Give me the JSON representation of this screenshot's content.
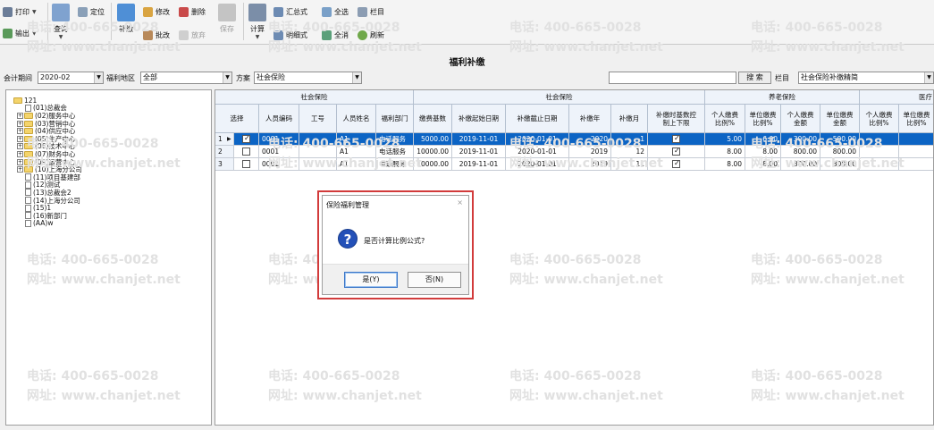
{
  "toolbar": {
    "print": "打印",
    "export": "输出",
    "query": "查询",
    "locate": "定位",
    "supplement": "补缴",
    "edit": "修改",
    "delete": "删除",
    "batch_edit": "批改",
    "void": "放弃",
    "save": "保存",
    "calculate": "计算",
    "summary_style": "汇总式",
    "detail_style": "明细式",
    "select_all": "全选",
    "deselect_all": "全消",
    "columns": "栏目",
    "refresh": "刷新"
  },
  "page_title": "福利补缴",
  "filters": {
    "period_label": "会计期间",
    "period_value": "2020-02",
    "region_label": "福利地区",
    "region_value": "全部",
    "plan_label": "方案",
    "plan_value": "社会保险",
    "search_button": "搜 索",
    "column_label": "栏目",
    "column_value": "社会保险补缴精简"
  },
  "tree": {
    "root": "121",
    "items": [
      {
        "label": "(01)总裁会",
        "expandable": false
      },
      {
        "label": "(02)服务中心",
        "expandable": true
      },
      {
        "label": "(03)营销中心",
        "expandable": true
      },
      {
        "label": "(04)供应中心",
        "expandable": true
      },
      {
        "label": "(05)生产中心",
        "expandable": true
      },
      {
        "label": "(06)技术中心",
        "expandable": true
      },
      {
        "label": "(07)财务中心",
        "expandable": true
      },
      {
        "label": "(09)运营中心",
        "expandable": true
      },
      {
        "label": "(10)上海分公司",
        "expandable": true
      },
      {
        "label": "(11)项目基建部",
        "expandable": false
      },
      {
        "label": "(12)测试",
        "expandable": false
      },
      {
        "label": "(13)总裁会2",
        "expandable": false
      },
      {
        "label": "(14)上海分公司",
        "expandable": false
      },
      {
        "label": "(15)1",
        "expandable": false
      },
      {
        "label": "(16)新部门",
        "expandable": false
      },
      {
        "label": "(AA)w",
        "expandable": false
      }
    ]
  },
  "grid": {
    "group_headers": {
      "social_left": "社会保险",
      "social_right": "社会保险",
      "pension": "养老保险",
      "medical": "医疗"
    },
    "columns": {
      "select": "选择",
      "emp_code": "人员编码",
      "job_no": "工号",
      "emp_name": "人员姓名",
      "welfare_dept": "福利部门",
      "base": "缴费基数",
      "start_date": "补缴起始日期",
      "end_date": "补缴截止日期",
      "year": "补缴年",
      "month": "补缴月",
      "limit": "补缴时基数控制上下限",
      "p_personal_rate": "个人缴费比例%",
      "p_company_rate": "单位缴费比例%",
      "p_personal_amt": "个人缴费金额",
      "p_company_amt": "单位缴费金额",
      "m_personal_rate": "个人缴费比例%",
      "m_company_rate": "单位缴费比例%"
    },
    "rows": [
      {
        "no": "1",
        "checked": true,
        "emp_code": "0001",
        "job_no": "",
        "emp_name": "A1",
        "dept": "电话服务",
        "base": "5000.00",
        "start": "2019-11-01",
        "end": "2020-01-01",
        "year": "2020",
        "month": "1",
        "limit": true,
        "pr": "5.00",
        "cr": "6.00",
        "pa": "300.00",
        "ca": "500.00"
      },
      {
        "no": "2",
        "checked": false,
        "emp_code": "0001",
        "job_no": "",
        "emp_name": "A1",
        "dept": "电话服务",
        "base": "10000.00",
        "start": "2019-11-01",
        "end": "2020-01-01",
        "year": "2019",
        "month": "12",
        "limit": true,
        "pr": "8.00",
        "cr": "8.00",
        "pa": "800.00",
        "ca": "800.00"
      },
      {
        "no": "3",
        "checked": false,
        "emp_code": "0001",
        "job_no": "",
        "emp_name": "A1",
        "dept": "电话服务",
        "base": "10000.00",
        "start": "2019-11-01",
        "end": "2020-01-01",
        "year": "2019",
        "month": "11",
        "limit": true,
        "pr": "8.00",
        "cr": "8.00",
        "pa": "800.00",
        "ca": "800.00"
      }
    ]
  },
  "dialog": {
    "title": "保险福利管理",
    "message": "是否计算比例公式?",
    "yes_button": "是(Y)",
    "no_button": "否(N)"
  },
  "watermark": {
    "phone": "电话: 400-665-0028",
    "url": "网址: www.chanjet.net"
  },
  "colors": {
    "selection": "#0c64c4",
    "dialog_highlight": "#d23b3b",
    "header_bg": "#eef3fa"
  }
}
